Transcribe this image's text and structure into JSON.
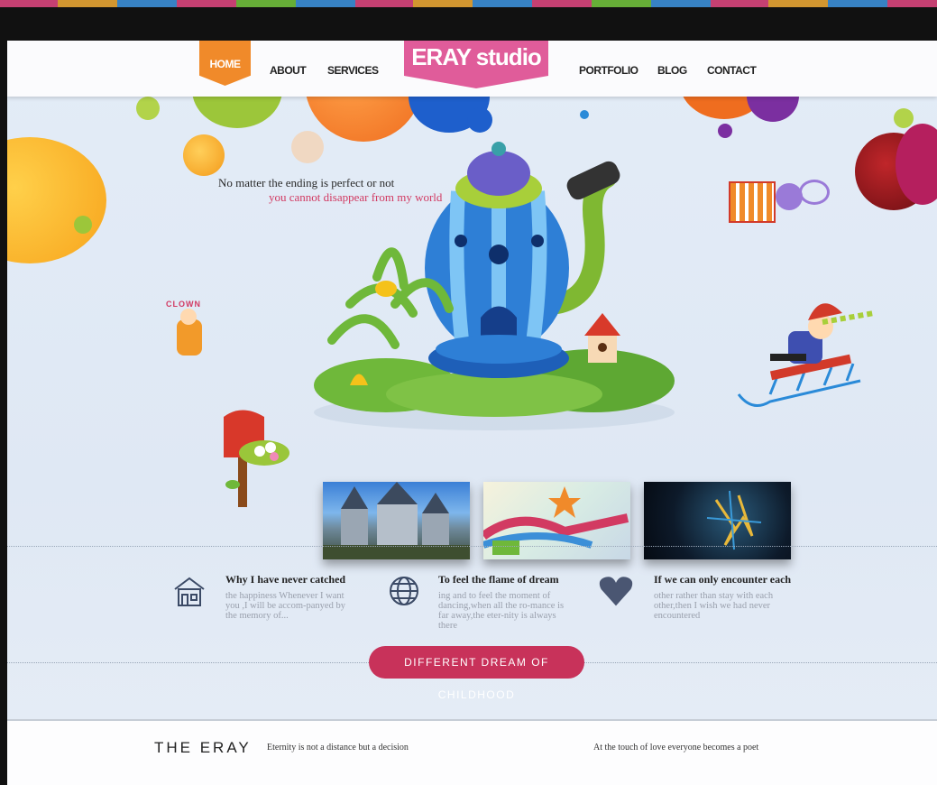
{
  "nav": {
    "home": "HOME",
    "about": "ABOUT",
    "services": "SERVICES",
    "logo": "ERAY studio",
    "portfolio": "PORTFOLIO",
    "blog": "BLOG",
    "contact": "CONTACT"
  },
  "hero": {
    "line1": "No matter the ending is perfect or not",
    "line2": "you cannot disappear from my world",
    "clown_sign": "CLOWN"
  },
  "features": [
    {
      "icon": "house-icon",
      "title": "Why I have never catched",
      "body": "the happiness  Whenever I want you ,I will be accom-panyed by the memory of..."
    },
    {
      "icon": "globe-icon",
      "title": "To feel the flame of dream",
      "body": "ing and to feel the moment of dancing,when all the ro-mance is far away,the eter-nity is always there"
    },
    {
      "icon": "heart-icon",
      "title": "If we can only encounter each",
      "body": "other rather than stay with each other,then I wish we had never encountered"
    }
  ],
  "cta": {
    "label": "DIFFERENT DREAM OF CHILDHOOD"
  },
  "footer": {
    "brand": "THE ERAY",
    "quote1": "Eternity is not a distance but a decision",
    "quote2": "At the touch of love everyone becomes a poet"
  },
  "colors": {
    "accent_orange": "#f08a2a",
    "logo_pink": "#e05c9a",
    "cta_red": "#c8325a"
  }
}
